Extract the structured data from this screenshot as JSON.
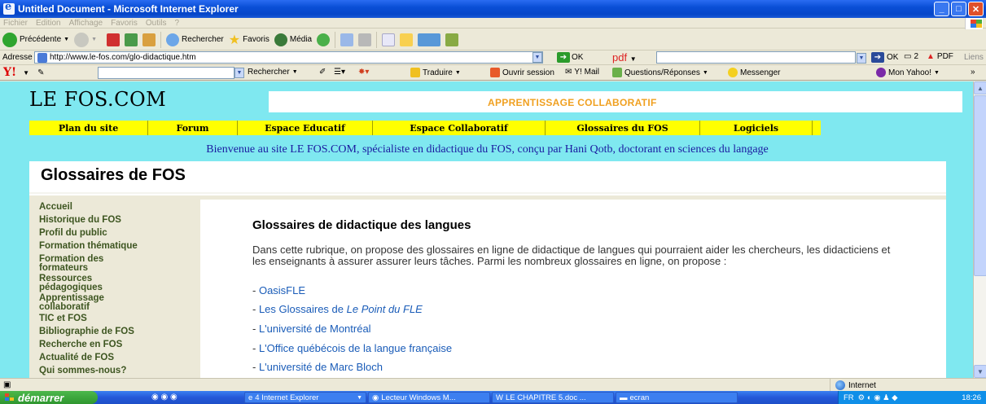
{
  "window": {
    "title": "Untitled Document - Microsoft Internet Explorer"
  },
  "menu": [
    "Fichier",
    "Edition",
    "Affichage",
    "Favoris",
    "Outils",
    "?"
  ],
  "toolbar": {
    "back_label": "Précédente",
    "search_label": "Rechercher",
    "favorites_label": "Favoris",
    "media_label": "Média"
  },
  "address": {
    "label": "Adresse",
    "url": "http://www.le-fos.com/glo-didactique.htm",
    "go_label": "OK",
    "pdf_label": "pdf",
    "ok2_label": "OK",
    "count_label": "2",
    "pdf_btn_label": "PDF",
    "links_label": "Liens"
  },
  "yahoo_toolbar": {
    "logo": "Y!",
    "search_label": "Rechercher",
    "traduire_label": "Traduire",
    "ouvrir_session_label": "Ouvrir session",
    "ymail_label": "Y! Mail",
    "questions_label": "Questions/Réponses",
    "messenger_label": "Messenger",
    "monyahoo_label": "Mon Yahoo!"
  },
  "site": {
    "logo": "LE FOS.COM",
    "slogan": "APPRENTISSAGE COLLABORATIF",
    "nav": [
      {
        "label": "Plan du site"
      },
      {
        "label": "Forum"
      },
      {
        "label": "Espace Educatif"
      },
      {
        "label": "Espace Collaboratif"
      },
      {
        "label": "Glossaires du FOS"
      },
      {
        "label": "Logiciels"
      }
    ],
    "welcome": "Bienvenue au site LE FOS.COM, spécialiste en didactique du FOS, conçu par Hani Qotb, doctorant en sciences du langage",
    "page_title": "Glossaires de FOS",
    "sidebar": [
      "Accueil",
      "Historique du FOS",
      "Profil du public",
      "Formation thématique",
      "Formation des formateurs",
      "Ressources pédagogiques",
      "Apprentissage collaboratif",
      "TIC et FOS",
      "Bibliographie de FOS",
      "Recherche en FOS",
      "Actualité de FOS",
      "Qui sommes-nous?"
    ],
    "main": {
      "heading": "Glossaires de didactique des langues",
      "intro": "Dans cette rubrique, on propose des glossaires en ligne de didactique de langues qui pourraient aider les chercheurs, les didacticiens et les enseignants à assurer assurer leurs tâches. Parmi les nombreux glossaires en ligne, on propose :",
      "links": [
        {
          "prefix": "- ",
          "text": "OasisFLE"
        },
        {
          "prefix": "- ",
          "text": "Les Glossaires de ",
          "italic": "Le Point du FLE"
        },
        {
          "prefix": "- ",
          "text": "L'université de Montréal"
        },
        {
          "prefix": "- ",
          "text": "L'Office québécois de la langue française"
        },
        {
          "prefix": "- ",
          "text": "L'université de Marc Bloch"
        }
      ]
    }
  },
  "status": {
    "zone": "Internet"
  },
  "taskbar": {
    "start_label": "démarrer",
    "tasks": [
      "4 Internet Explorer",
      "Lecteur Windows M...",
      "LE CHAPITRE 5.doc ...",
      "ecran"
    ],
    "lang": "FR",
    "clock": "18:26"
  },
  "colors": {
    "page_bg": "#7fe8f0",
    "nav_yellow": "#ffff00",
    "slogan_orange": "#f0a020",
    "welcome_blue": "#1a1aa0",
    "sidebar_green": "#3d5520",
    "link_blue": "#1a5cb8"
  }
}
